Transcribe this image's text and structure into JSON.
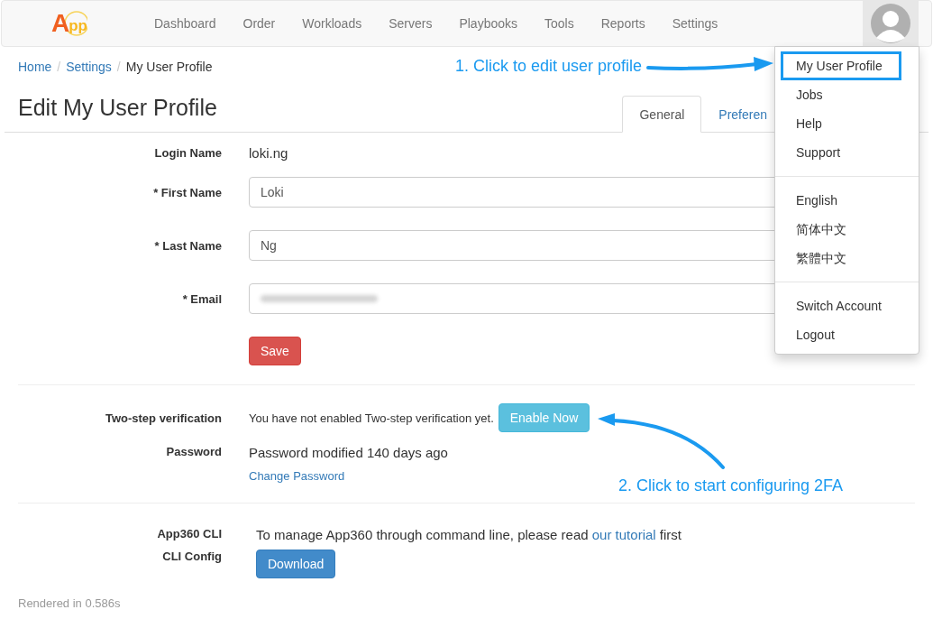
{
  "navbar": {
    "logo": {
      "first": "A",
      "rest": "pp"
    },
    "items": [
      "Dashboard",
      "Order",
      "Workloads",
      "Servers",
      "Playbooks",
      "Tools",
      "Reports",
      "Settings"
    ]
  },
  "breadcrumb": [
    {
      "label": "Home",
      "link": true
    },
    {
      "separator": "/",
      "label": "Settings",
      "link": true
    },
    {
      "separator": "/",
      "label": "My User Profile",
      "link": false
    }
  ],
  "page_title": "Edit My User Profile",
  "tabs": [
    {
      "label": "General",
      "selected": true
    },
    {
      "label": "Preferen",
      "selected": false
    }
  ],
  "profile_form": {
    "rows": [
      {
        "kind": "static",
        "label": "Login Name",
        "value": "loki.ng"
      },
      {
        "kind": "input",
        "label": "* First Name",
        "value": "Loki"
      },
      {
        "kind": "input",
        "label": "* Last Name",
        "value": "Ng"
      },
      {
        "kind": "blurred",
        "label": "* Email"
      }
    ],
    "save_button": "Save"
  },
  "security": {
    "two_step": {
      "label": "Two-step verification",
      "text": "You have not enabled Two-step verification yet.",
      "button": "Enable Now"
    },
    "password": {
      "label": "Password",
      "text": "Password modified 140 days ago",
      "link": "Change Password"
    }
  },
  "cli": {
    "label": "App360 CLI",
    "text_before": "To manage App360 through command line, please read",
    "link": "our tutorial",
    "text_after": "first",
    "config_label": "CLI Config",
    "button": "Download"
  },
  "footer": "Rendered in 0.586s",
  "user_menu": {
    "groups": [
      [
        {
          "label": "My User Profile",
          "highlighted": true
        },
        {
          "label": "Jobs",
          "highlighted": false
        },
        {
          "label": "Help",
          "highlighted": false
        },
        {
          "label": "Support",
          "highlighted": false
        }
      ],
      [
        {
          "label": "English",
          "highlighted": false
        },
        {
          "label": "简体中文",
          "highlighted": false
        },
        {
          "label": "繁體中文",
          "highlighted": false
        }
      ],
      [
        {
          "label": "Switch Account",
          "highlighted": false
        },
        {
          "label": "Logout",
          "highlighted": false
        }
      ]
    ]
  },
  "annotations": [
    "1. Click to edit user profile",
    "2. Click to start configuring 2FA"
  ]
}
